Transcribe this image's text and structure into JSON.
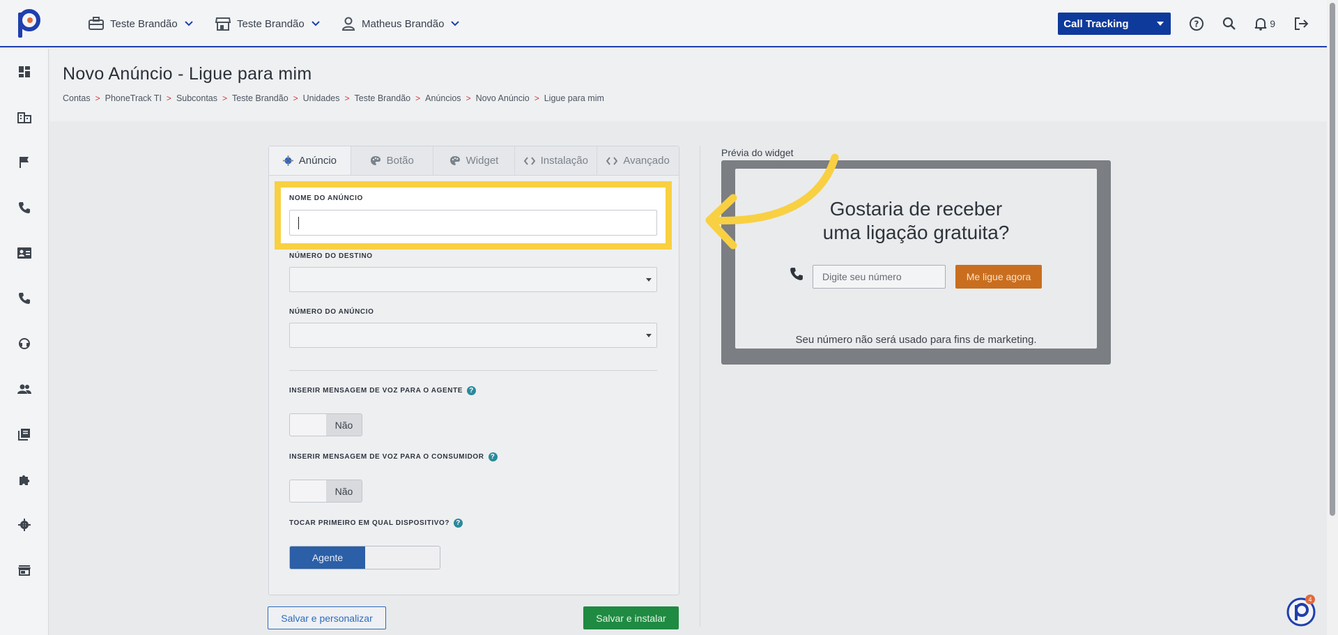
{
  "header": {
    "account_label": "Teste Brandão",
    "store_label": "Teste Brandão",
    "user_label": "Matheus Brandão",
    "product_select": "Call Tracking",
    "notifications_count": "9"
  },
  "page": {
    "title": "Novo Anúncio - Ligue para mim",
    "breadcrumbs": [
      "Contas",
      "PhoneTrack TI",
      "Subcontas",
      "Teste Brandão",
      "Unidades",
      "Teste Brandão",
      "Anúncios",
      "Novo Anúncio",
      "Ligue para mim"
    ]
  },
  "tabs": [
    {
      "label": "Anúncio",
      "icon": "gear-icon",
      "active": true
    },
    {
      "label": "Botão",
      "icon": "palette-icon",
      "active": false
    },
    {
      "label": "Widget",
      "icon": "palette-icon",
      "active": false
    },
    {
      "label": "Instalação",
      "icon": "code-icon",
      "active": false
    },
    {
      "label": "Avançado",
      "icon": "code-icon",
      "active": false
    }
  ],
  "form": {
    "ad_name_label": "NOME DO ANÚNCIO",
    "ad_name_value": "",
    "dest_number_label": "NÚMERO DO DESTINO",
    "ad_number_label": "NÚMERO DO ANÚNCIO",
    "voice_agent_label": "INSERIR MENSAGEM DE VOZ PARA O AGENTE",
    "voice_agent_value": "Não",
    "voice_consumer_label": "INSERIR MENSAGEM DE VOZ PARA O CONSUMIDOR",
    "voice_consumer_value": "Não",
    "first_ring_label": "TOCAR PRIMEIRO EM QUAL DISPOSITIVO?",
    "first_ring_value": "Agente",
    "help_glyph": "?"
  },
  "actions": {
    "save_customize": "Salvar e personalizar",
    "save_install": "Salvar e instalar"
  },
  "preview": {
    "label": "Prévia do widget",
    "heading_line1": "Gostaria de receber",
    "heading_line2": "uma ligação gratuita?",
    "input_placeholder": "Digite seu número",
    "button_label": "Me ligue agora",
    "note": "Seu número não será usado para fins de marketing."
  },
  "chat_badge": "4",
  "colors": {
    "highlight": "#f8d042",
    "primary": "#0e3a9c",
    "success": "#1f8a41",
    "cta_orange": "#c96e1e"
  }
}
